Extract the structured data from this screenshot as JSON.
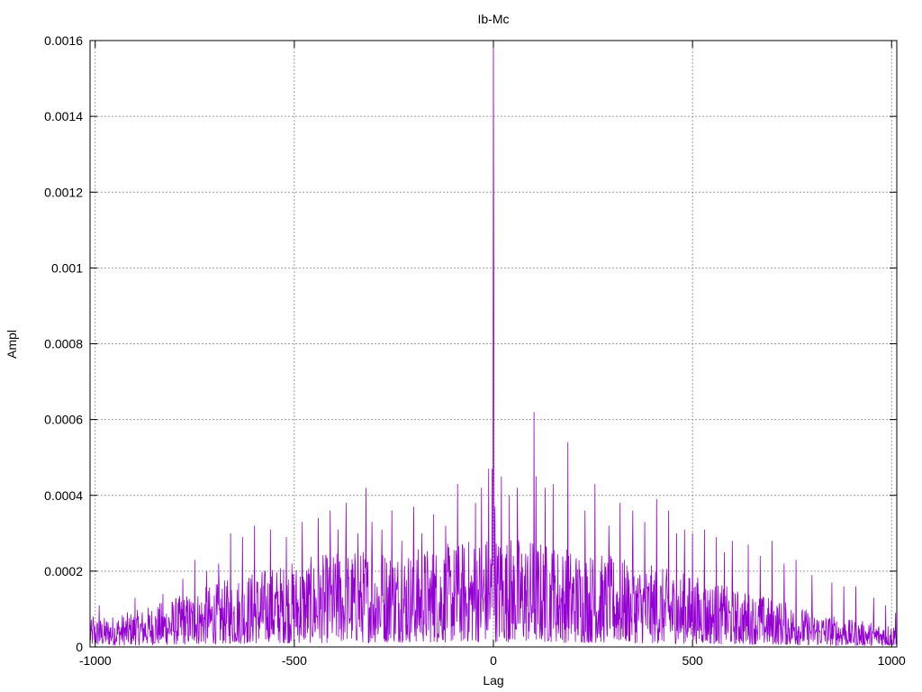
{
  "chart_data": {
    "type": "line",
    "title": "Ib-Mc",
    "xlabel": "Lag",
    "ylabel": "Ampl",
    "xlim": [
      -1013,
      1013
    ],
    "ylim": [
      0,
      0.0016
    ],
    "x_ticks": [
      -1000,
      -500,
      0,
      500,
      1000
    ],
    "x_tick_labels": [
      "-1000",
      "-500",
      "0",
      "500",
      "1000"
    ],
    "y_ticks": [
      0,
      0.0002,
      0.0004,
      0.0006,
      0.0008,
      0.001,
      0.0012,
      0.0014,
      0.0016
    ],
    "y_tick_labels": [
      "0",
      "0.0002",
      "0.0004",
      "0.0006",
      "0.0008",
      "0.001",
      "0.0012",
      "0.0014",
      "0.0016"
    ],
    "grid": true,
    "series": [
      {
        "color": "#9400d3",
        "envelope_x": [
          -1013,
          -900,
          -800,
          -700,
          -600,
          -500,
          -400,
          -300,
          -200,
          -100,
          -20,
          0,
          20,
          100,
          200,
          300,
          400,
          500,
          600,
          700,
          800,
          900,
          1013
        ],
        "envelope_y": [
          6e-05,
          8e-05,
          0.00011,
          0.00014,
          0.00017,
          0.00019,
          0.00021,
          0.00022,
          0.00022,
          0.00023,
          0.00025,
          0.00025,
          0.00025,
          0.00024,
          0.00022,
          0.0002,
          0.00018,
          0.00016,
          0.00013,
          0.00011,
          8e-05,
          6e-05,
          5e-05
        ],
        "peaks": [
          [
            0,
            0.0016
          ],
          [
            1,
            0.00098
          ],
          [
            -1,
            0.0005
          ],
          [
            -3,
            0.00047
          ],
          [
            -12,
            0.00047
          ],
          [
            4,
            0.00037
          ],
          [
            102,
            0.00062
          ],
          [
            107,
            0.00045
          ],
          [
            187,
            0.00054
          ],
          [
            20,
            0.00045
          ],
          [
            -30,
            0.00042
          ],
          [
            -90,
            0.00043
          ],
          [
            -320,
            0.00042
          ],
          [
            -370,
            0.00038
          ],
          [
            -410,
            0.00036
          ],
          [
            -255,
            0.00036
          ],
          [
            -150,
            0.00035
          ],
          [
            -45,
            0.00038
          ],
          [
            255,
            0.00043
          ],
          [
            318,
            0.00038
          ],
          [
            350,
            0.00036
          ],
          [
            410,
            0.00039
          ],
          [
            440,
            0.00036
          ],
          [
            480,
            0.00031
          ],
          [
            530,
            0.00031
          ],
          [
            560,
            0.00029
          ],
          [
            600,
            0.00028
          ],
          [
            640,
            0.00027
          ],
          [
            700,
            0.00028
          ],
          [
            -200,
            0.00037
          ],
          [
            -305,
            0.00033
          ],
          [
            -440,
            0.00034
          ],
          [
            -480,
            0.00033
          ],
          [
            -560,
            0.00031
          ],
          [
            -600,
            0.00032
          ],
          [
            -630,
            0.00029
          ],
          [
            -660,
            0.0003
          ],
          [
            -690,
            0.00022
          ],
          [
            -780,
            0.00018
          ],
          [
            -830,
            0.00014
          ],
          [
            -900,
            0.00013
          ],
          [
            -990,
            0.00011
          ],
          [
            -1005,
            8e-05
          ],
          [
            760,
            0.00023
          ],
          [
            850,
            0.00017
          ],
          [
            910,
            0.00016
          ],
          [
            955,
            0.00013
          ],
          [
            985,
            0.00011
          ],
          [
            1010,
            9e-05
          ],
          [
            150,
            0.00043
          ],
          [
            130,
            0.00042
          ],
          [
            60,
            0.00042
          ],
          [
            40,
            0.0004
          ],
          [
            -120,
            0.00032
          ],
          [
            -180,
            0.0003
          ],
          [
            -230,
            0.00028
          ],
          [
            -280,
            0.00031
          ],
          [
            -340,
            0.0003
          ],
          [
            -390,
            0.00031
          ],
          [
            -520,
            0.00029
          ],
          [
            -720,
            0.0002
          ],
          [
            -750,
            0.00023
          ],
          [
            230,
            0.00036
          ],
          [
            290,
            0.00032
          ],
          [
            380,
            0.00033
          ],
          [
            460,
            0.0003
          ],
          [
            500,
            0.0003
          ],
          [
            580,
            0.00025
          ],
          [
            670,
            0.00024
          ],
          [
            730,
            0.00022
          ],
          [
            800,
            0.00019
          ],
          [
            880,
            0.00016
          ]
        ],
        "seed": 12345
      }
    ]
  }
}
